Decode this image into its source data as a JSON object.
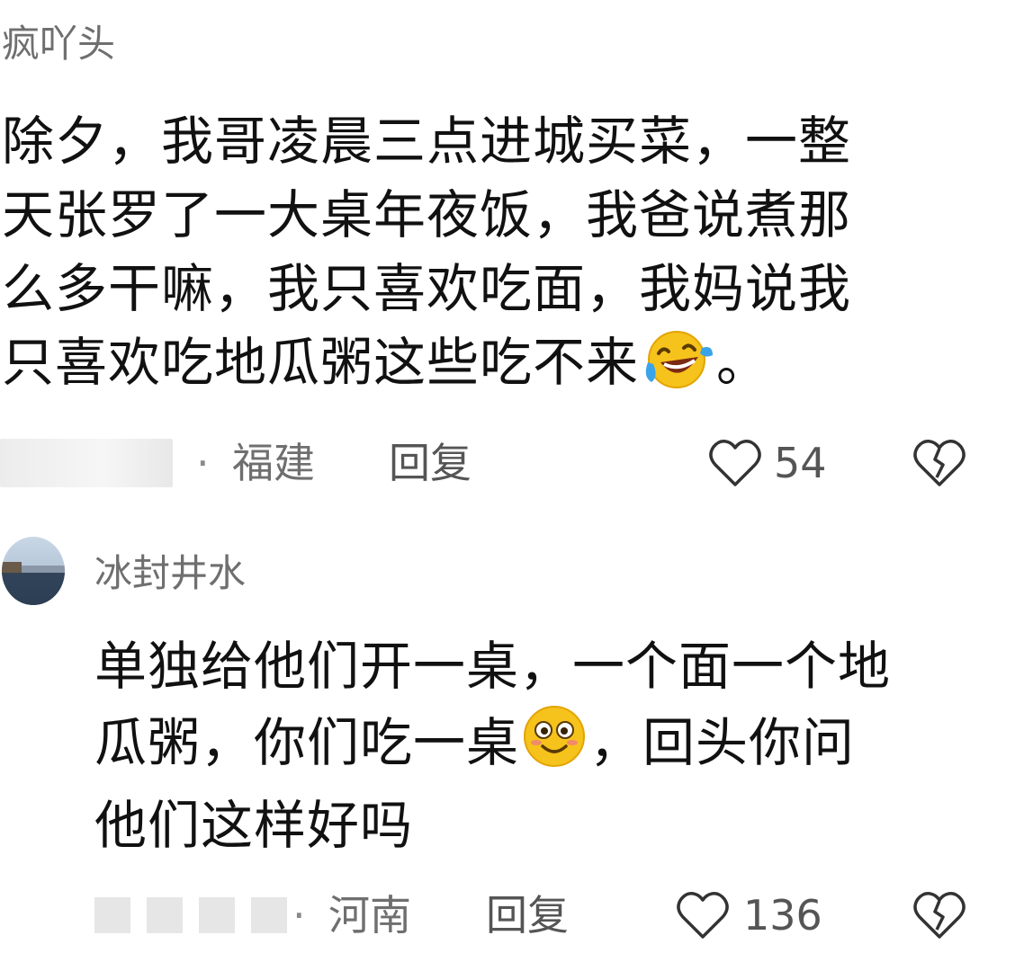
{
  "comment1": {
    "username": "疯吖头",
    "lines": [
      "除夕，我哥凌晨三点进城买菜，一整",
      "天张罗了一大桌年夜饭，我爸说煮那",
      "么多干嘛，我只喜欢吃面，我妈说我",
      "只喜欢吃地瓜粥这些吃不来"
    ],
    "line4_end": "。",
    "emoji_icon": "laughing-crying-emoji-icon",
    "location": "福建",
    "separator": "·",
    "reply_label": "回复",
    "likes": "54",
    "like_icon": "heart-outline-icon",
    "dislike_icon": "broken-heart-icon"
  },
  "comment2": {
    "username": "冰封井水",
    "line1": "单独给他们开一桌，一个面一个地",
    "line2_start": "瓜粥，你们吃一桌",
    "line2_end": "，回头你问",
    "line3": "他们这样好吗",
    "emoji_icon": "smiling-emoji-icon",
    "location": "河南",
    "separator": "·",
    "reply_label": "回复",
    "likes": "136",
    "like_icon": "heart-outline-icon",
    "dislike_icon": "broken-heart-icon"
  },
  "colors": {
    "text": "#111111",
    "meta": "#6f6f6f",
    "emoji": "#f5c518"
  }
}
